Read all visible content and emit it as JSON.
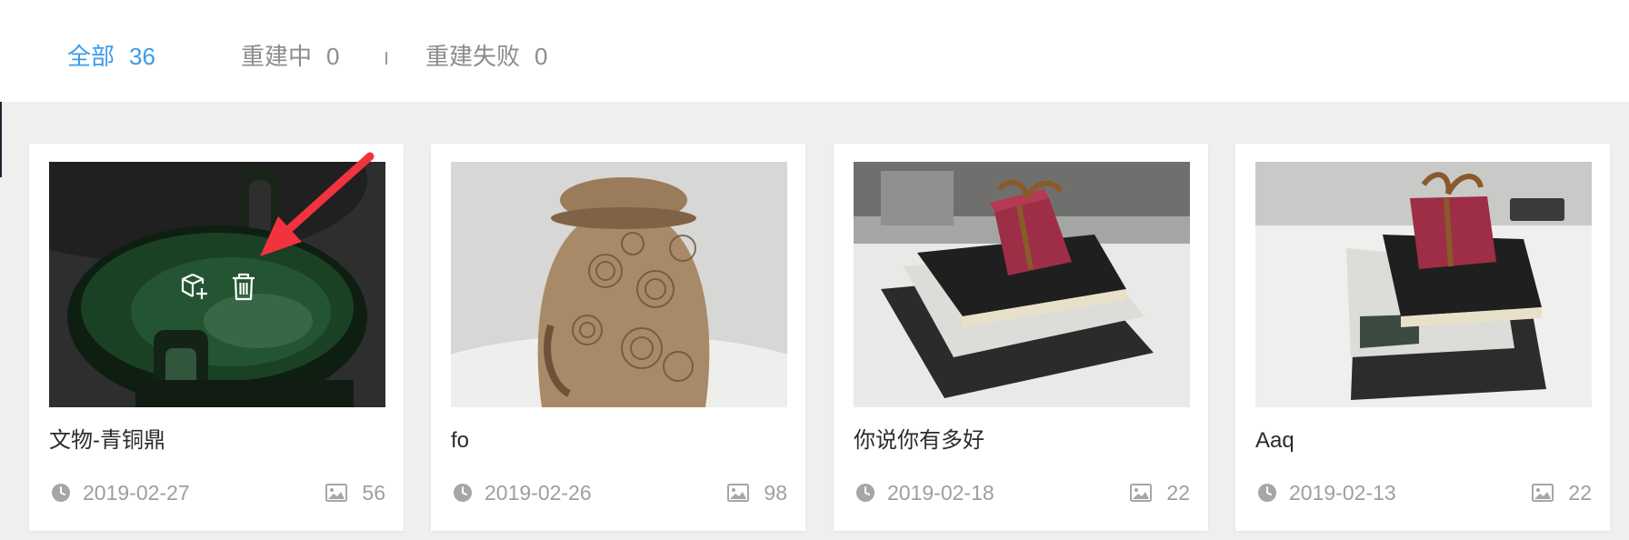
{
  "tabs": {
    "all": {
      "label": "全部",
      "count": "36"
    },
    "rebuilding": {
      "label": "重建中",
      "count": "0"
    },
    "failed": {
      "label": "重建失败",
      "count": "0"
    }
  },
  "colors": {
    "accent": "#3d9be9",
    "muted": "#8c8c8c",
    "annotation_arrow": "#f2333f"
  },
  "cards": [
    {
      "title": "文物-青铜鼎",
      "date": "2019-02-27",
      "image_count": "56",
      "hover_actions": [
        "add-to-model-icon",
        "trash-icon"
      ]
    },
    {
      "title": "fo",
      "date": "2019-02-26",
      "image_count": "98"
    },
    {
      "title": "你说你有多好",
      "date": "2019-02-18",
      "image_count": "22"
    },
    {
      "title": "Aaq",
      "date": "2019-02-13",
      "image_count": "22"
    }
  ]
}
